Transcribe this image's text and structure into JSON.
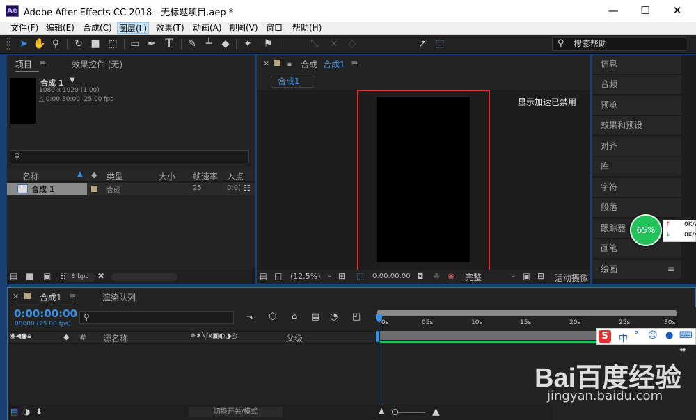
{
  "window": {
    "logo": "Ae",
    "title": "Adobe After Effects CC 2018 - 无标题项目.aep *",
    "minimize": "—",
    "maximize": "☐",
    "close": "✕"
  },
  "menu": [
    "文件(F)",
    "编辑(E)",
    "合成(C)",
    "图层(L)",
    "效果(T)",
    "动画(A)",
    "视图(V)",
    "窗口",
    "帮助(H)"
  ],
  "toolbar": {
    "snap_label": "对齐",
    "more": "»",
    "search_placeholder": "搜索帮助"
  },
  "project": {
    "tab_project": "项目",
    "tab_effects": "效果控件 (无)",
    "comp_name": "合成 1",
    "comp_size": "1080 x 1920 (1.00)",
    "comp_duration": "△ 0:00:30:00, 25.00 fps",
    "search_placeholder": "",
    "columns": [
      "名称",
      "类型",
      "大小",
      "帧速率",
      "入点"
    ],
    "row": {
      "name": "合成 1",
      "type": "合成",
      "fps": "25",
      "in": "0:0("
    },
    "bpc": "8 bpc"
  },
  "viewer": {
    "tab_label": "合成",
    "tab_name": "合成1",
    "sub_tab": "合成1",
    "gpu_msg": "显示加速已禁用",
    "zoom": "(12.5%)",
    "timecode": "0:00:00:00",
    "quality": "完整",
    "camera": "活动摄像"
  },
  "side": [
    "信息",
    "音频",
    "预览",
    "效果和预设",
    "对齐",
    "库",
    "字符",
    "段落",
    "跟踪器",
    "画笔",
    "绘画"
  ],
  "timeline": {
    "tab_comp": "合成1",
    "tab_render": "渲染队列",
    "timecode": "0:00:00:00",
    "frames": "00000 (25.00 fps)",
    "col_name": "源名称",
    "col_parent": "父级",
    "ruler": [
      "0s",
      "05s",
      "10s",
      "15s",
      "20s",
      "25s",
      "30s"
    ],
    "toggle_label": "切换开关/模式"
  },
  "overlays": {
    "net_percent": "65%",
    "net_up": "0K/s",
    "net_down": "0K/s",
    "ime": "中",
    "watermark_url": "jingyan.baidu.com",
    "watermark_brand": "Bai百度经验"
  },
  "colors": {
    "accent": "#2f8fe6",
    "highlight": "#e53030",
    "green": "#22c35a"
  }
}
